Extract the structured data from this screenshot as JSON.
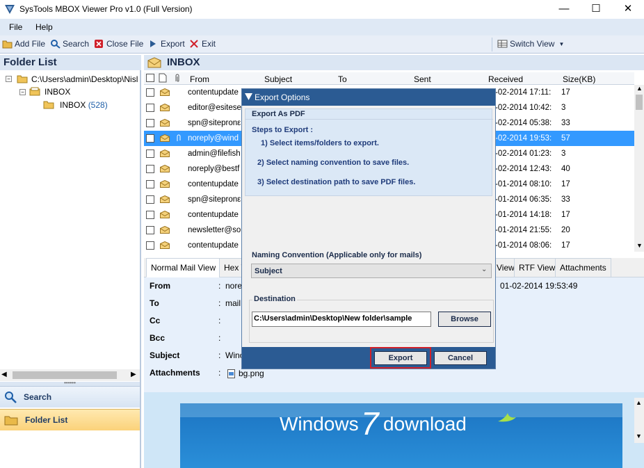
{
  "window": {
    "title": "SysTools MBOX Viewer Pro v1.0 (Full Version)",
    "minimize": "—",
    "maximize": "☐",
    "close": "✕"
  },
  "menu": {
    "file": "File",
    "help": "Help"
  },
  "toolbar": {
    "add_file": "Add File",
    "search": "Search",
    "close_file": "Close File",
    "export": "Export",
    "exit": "Exit",
    "switch_view": "Switch View"
  },
  "left": {
    "title": "Folder List",
    "tree_root": "C:\\Users\\admin\\Desktop\\Nisl",
    "tree_inbox": "INBOX",
    "tree_inbox_child": "INBOX",
    "tree_inbox_count": "(528)",
    "nav_search": "Search",
    "nav_folder_list": "Folder List"
  },
  "inbox": {
    "title": "INBOX",
    "columns": [
      "From",
      "Subject",
      "To",
      "Sent",
      "Received",
      "Size(KB)"
    ],
    "rows": [
      {
        "from": "contentupdate",
        "received": "-02-2014 17:11:",
        "size": "17"
      },
      {
        "from": "editor@esitese",
        "received": "-02-2014 10:42:",
        "size": "3"
      },
      {
        "from": "spn@sitepronε",
        "received": "-02-2014 05:38:",
        "size": "33"
      },
      {
        "from": "noreply@wind",
        "received": "-02-2014 19:53:",
        "size": "57"
      },
      {
        "from": "admin@filefish",
        "received": "-02-2014 01:23:",
        "size": "3"
      },
      {
        "from": "noreply@bestf",
        "received": "-02-2014 12:43:",
        "size": "40"
      },
      {
        "from": "contentupdate",
        "received": "-01-2014 08:10:",
        "size": "17"
      },
      {
        "from": "spn@sitepronε",
        "received": "-01-2014 06:35:",
        "size": "33"
      },
      {
        "from": "contentupdate",
        "received": "-01-2014 14:18:",
        "size": "17"
      },
      {
        "from": "newsletter@so",
        "received": "-01-2014 21:55:",
        "size": "20"
      },
      {
        "from": "contentupdate",
        "received": "-01-2014 08:06:",
        "size": "17"
      }
    ]
  },
  "tabs": {
    "normal": "Normal Mail View",
    "hex": "Hex V",
    "view": "View",
    "rtf": "RTF View",
    "attachments": "Attachments"
  },
  "detail": {
    "from_label": "From",
    "from_value": "nore",
    "to_label": "To",
    "to_value": "mail",
    "cc_label": "Cc",
    "bcc_label": "Bcc",
    "subject_label": "Subject",
    "subject_value": "Winc",
    "attachments_label": "Attachments",
    "attachment_file": "bg.png",
    "date": "01-02-2014 19:53:49",
    "colon": ":"
  },
  "banner": {
    "text_left": "Windows",
    "seven": "7",
    "text_right": "download"
  },
  "modal": {
    "title": "Export Options",
    "export_as": "Export As PDF",
    "steps_title": "Steps to Export :",
    "step1": "1) Select items/folders to export.",
    "step2": "2) Select naming convention to save files.",
    "step3": "3) Select destination path to save PDF files.",
    "naming_label": "Naming Convention (Applicable only for mails)",
    "naming_value": "Subject",
    "destination_label": "Destination",
    "destination_value": "C:\\Users\\admin\\Desktop\\New folder\\sample",
    "browse": "Browse",
    "export_btn": "Export",
    "cancel_btn": "Cancel"
  },
  "colors": {
    "accent": "#2b5b93",
    "selection": "#3399ff",
    "highlight_border": "#d0202a"
  }
}
